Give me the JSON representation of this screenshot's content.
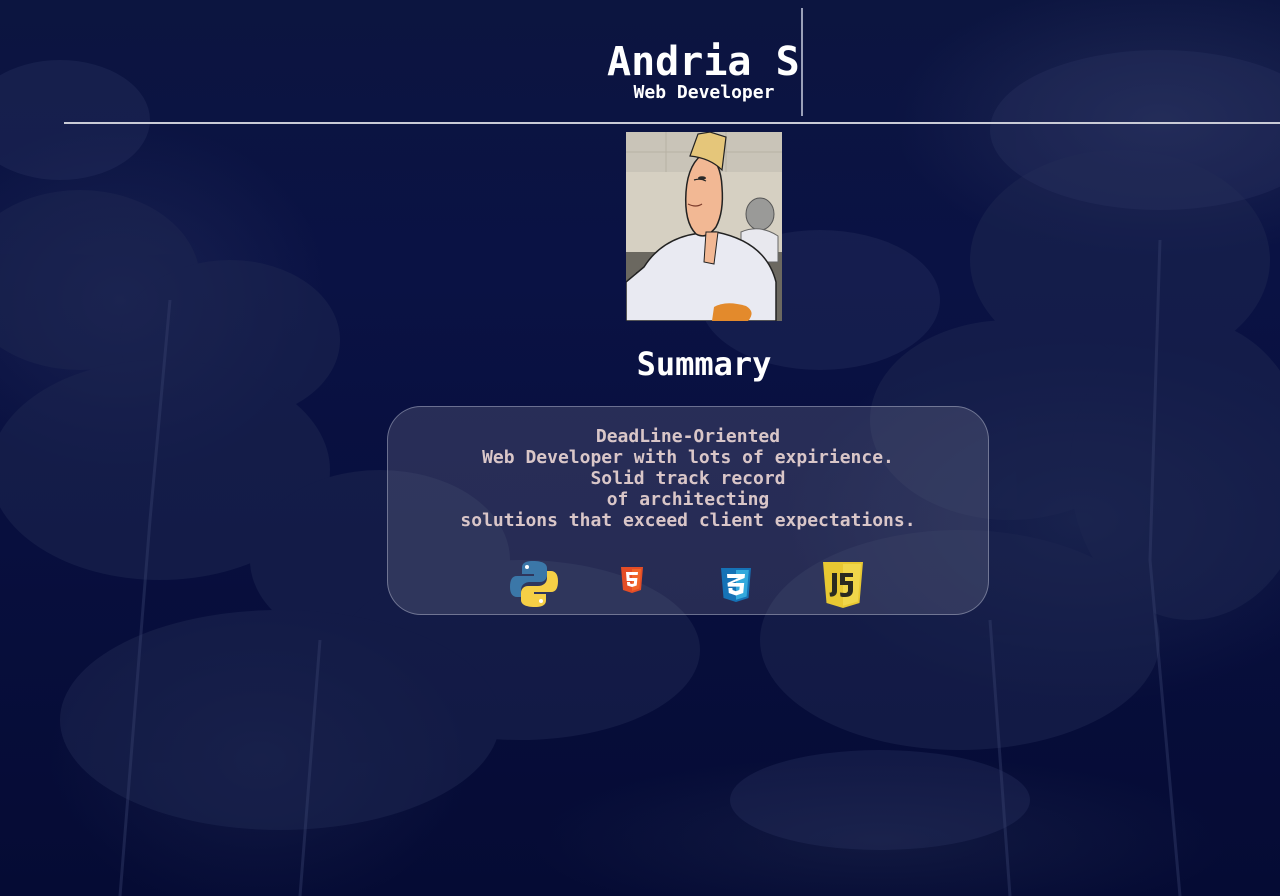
{
  "header": {
    "name": "Andria Shmatsko",
    "role": "Web Developer"
  },
  "avatar": {
    "description_icon": "profile-photo"
  },
  "summary_section": {
    "title": "Summary",
    "lines": [
      "DeadLine-Oriented",
      "Web Developer with lots of expirience.",
      "Solid track record",
      "of architecting",
      "solutions that exceed client expectations."
    ]
  },
  "skills": [
    {
      "name": "python-icon",
      "color": "#3b77a8"
    },
    {
      "name": "html5-icon",
      "color": "#e44d26"
    },
    {
      "name": "css3-icon",
      "color": "#1572b6"
    },
    {
      "name": "javascript-icon",
      "color": "#e8c832"
    }
  ],
  "colors": {
    "background": "#0a1244",
    "text": "#ffffff",
    "summary_text": "#d9c6c8",
    "divider": "#c9cbd6"
  }
}
